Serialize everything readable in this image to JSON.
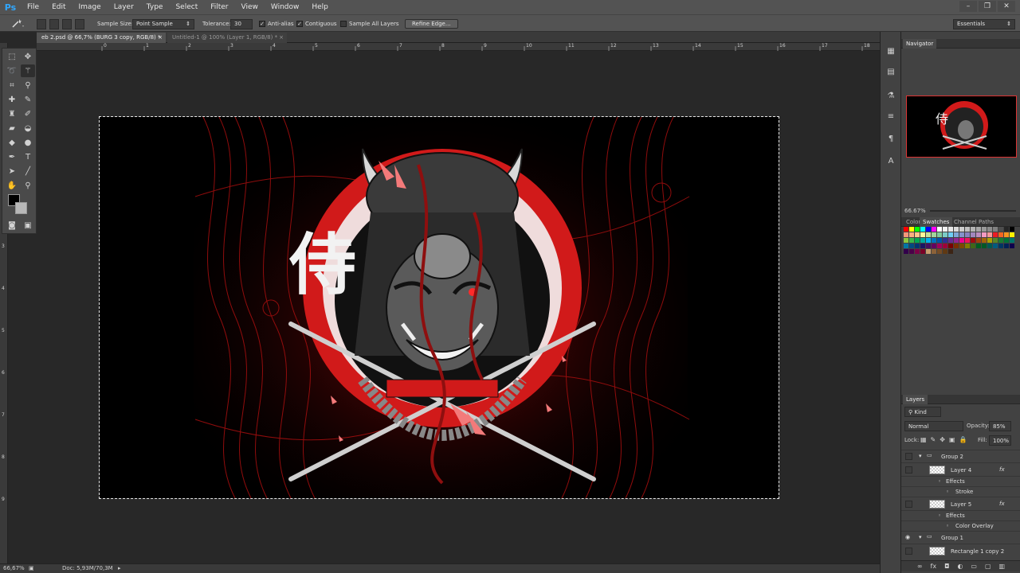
{
  "app": {
    "logo": "Ps"
  },
  "menu": [
    "File",
    "Edit",
    "Image",
    "Layer",
    "Type",
    "Select",
    "Filter",
    "View",
    "Window",
    "Help"
  ],
  "window_controls": {
    "minimize": "–",
    "restore": "❐",
    "close": "✕"
  },
  "options": {
    "sample_size_label": "Sample Size:",
    "sample_size_value": "Point Sample",
    "tolerance_label": "Tolerance:",
    "tolerance_value": "30",
    "anti_alias_label": "Anti-alias",
    "contiguous_label": "Contiguous",
    "sample_all_layers_label": "Sample All Layers",
    "refine_edge_label": "Refine Edge...",
    "workspace": "Essentials",
    "anti_alias_checked": true,
    "contiguous_checked": true,
    "sample_all_layers_checked": false
  },
  "tabs": [
    {
      "label": "eb 2.psd @ 66,7% (BURG 3 copy, RGB/8) *",
      "close": "×"
    },
    {
      "label": "Untitled-1 @ 100% (Layer 1, RGB/8) *",
      "close": "×"
    }
  ],
  "ruler_top": [
    "0",
    "1",
    "2",
    "3",
    "4",
    "5",
    "6",
    "7",
    "8",
    "9",
    "10",
    "11",
    "12",
    "13",
    "14",
    "15",
    "16",
    "17",
    "18"
  ],
  "ruler_left": [
    "1",
    "2",
    "3",
    "4",
    "5",
    "6",
    "7",
    "8",
    "9"
  ],
  "status": {
    "zoom": "66,67%",
    "doc": "Doc: 5,93M/70,3M"
  },
  "artwork": {
    "kanji": "侍"
  },
  "navigator": {
    "title": "Navigator",
    "zoom": "66.67%"
  },
  "swatches_tabs": [
    "Color",
    "Swatches",
    "Channel",
    "Paths"
  ],
  "swatch_colors": [
    "#ff0000",
    "#ffff00",
    "#00ff00",
    "#00ffff",
    "#0000ff",
    "#ff00ff",
    "#ffffff",
    "#f2f2f2",
    "#e6e6e6",
    "#d9d9d9",
    "#cccccc",
    "#bfbfbf",
    "#b3b3b3",
    "#a6a6a6",
    "#999999",
    "#8c8c8c",
    "#808080",
    "#4d4d4d",
    "#262626",
    "#000000",
    "#f7977a",
    "#f9ad81",
    "#fdc68a",
    "#fff79a",
    "#c4df9b",
    "#a3d39c",
    "#82ca9d",
    "#7bcdc8",
    "#6ecff6",
    "#7ea7d8",
    "#8493ca",
    "#8882be",
    "#a187be",
    "#bc8dbf",
    "#f49ac2",
    "#f6989d",
    "#ed1c24",
    "#f26522",
    "#f7941d",
    "#fff200",
    "#8dc63f",
    "#39b54a",
    "#00a651",
    "#00a99d",
    "#00aeef",
    "#0072bc",
    "#0054a6",
    "#2e3192",
    "#662d91",
    "#92278f",
    "#ec008c",
    "#ed145b",
    "#9e0b0f",
    "#a0410d",
    "#a36209",
    "#aba000",
    "#598527",
    "#197b30",
    "#007236",
    "#00746b",
    "#0076a3",
    "#004a80",
    "#003471",
    "#1b1464",
    "#440e62",
    "#630460",
    "#9e005d",
    "#9e0039",
    "#790000",
    "#7b2e00",
    "#7d4900",
    "#827b00",
    "#406618",
    "#005e20",
    "#005826",
    "#005952",
    "#005b7f",
    "#003663",
    "#002157",
    "#0d004c",
    "#32004b",
    "#4b0049",
    "#7b0046",
    "#7a0026",
    "#c69c6d",
    "#8c6239",
    "#754c24",
    "#603913",
    "#3c2415"
  ],
  "layers_panel": {
    "title": "Layers",
    "filter": "Kind",
    "blend_mode": "Normal",
    "opacity_label": "Opacity:",
    "opacity_value": "85%",
    "lock_label": "Lock:",
    "fill_label": "Fill:",
    "fill_value": "100%"
  },
  "layers": [
    {
      "name": "Group 2",
      "type": "group"
    },
    {
      "name": "Layer 4",
      "type": "layer",
      "fx": "fx"
    },
    {
      "name": "Effects",
      "type": "effects"
    },
    {
      "name": "Stroke",
      "type": "effect"
    },
    {
      "name": "Layer 5",
      "type": "layer",
      "fx": "fx"
    },
    {
      "name": "Effects",
      "type": "effects"
    },
    {
      "name": "Color Overlay",
      "type": "effect"
    },
    {
      "name": "Group 1",
      "type": "group"
    },
    {
      "name": "Rectangle 1 copy 2",
      "type": "layer"
    }
  ],
  "colors": {
    "foreground": "#000000",
    "background": "#b8b8b8",
    "accent_red": "#d11a1a"
  }
}
